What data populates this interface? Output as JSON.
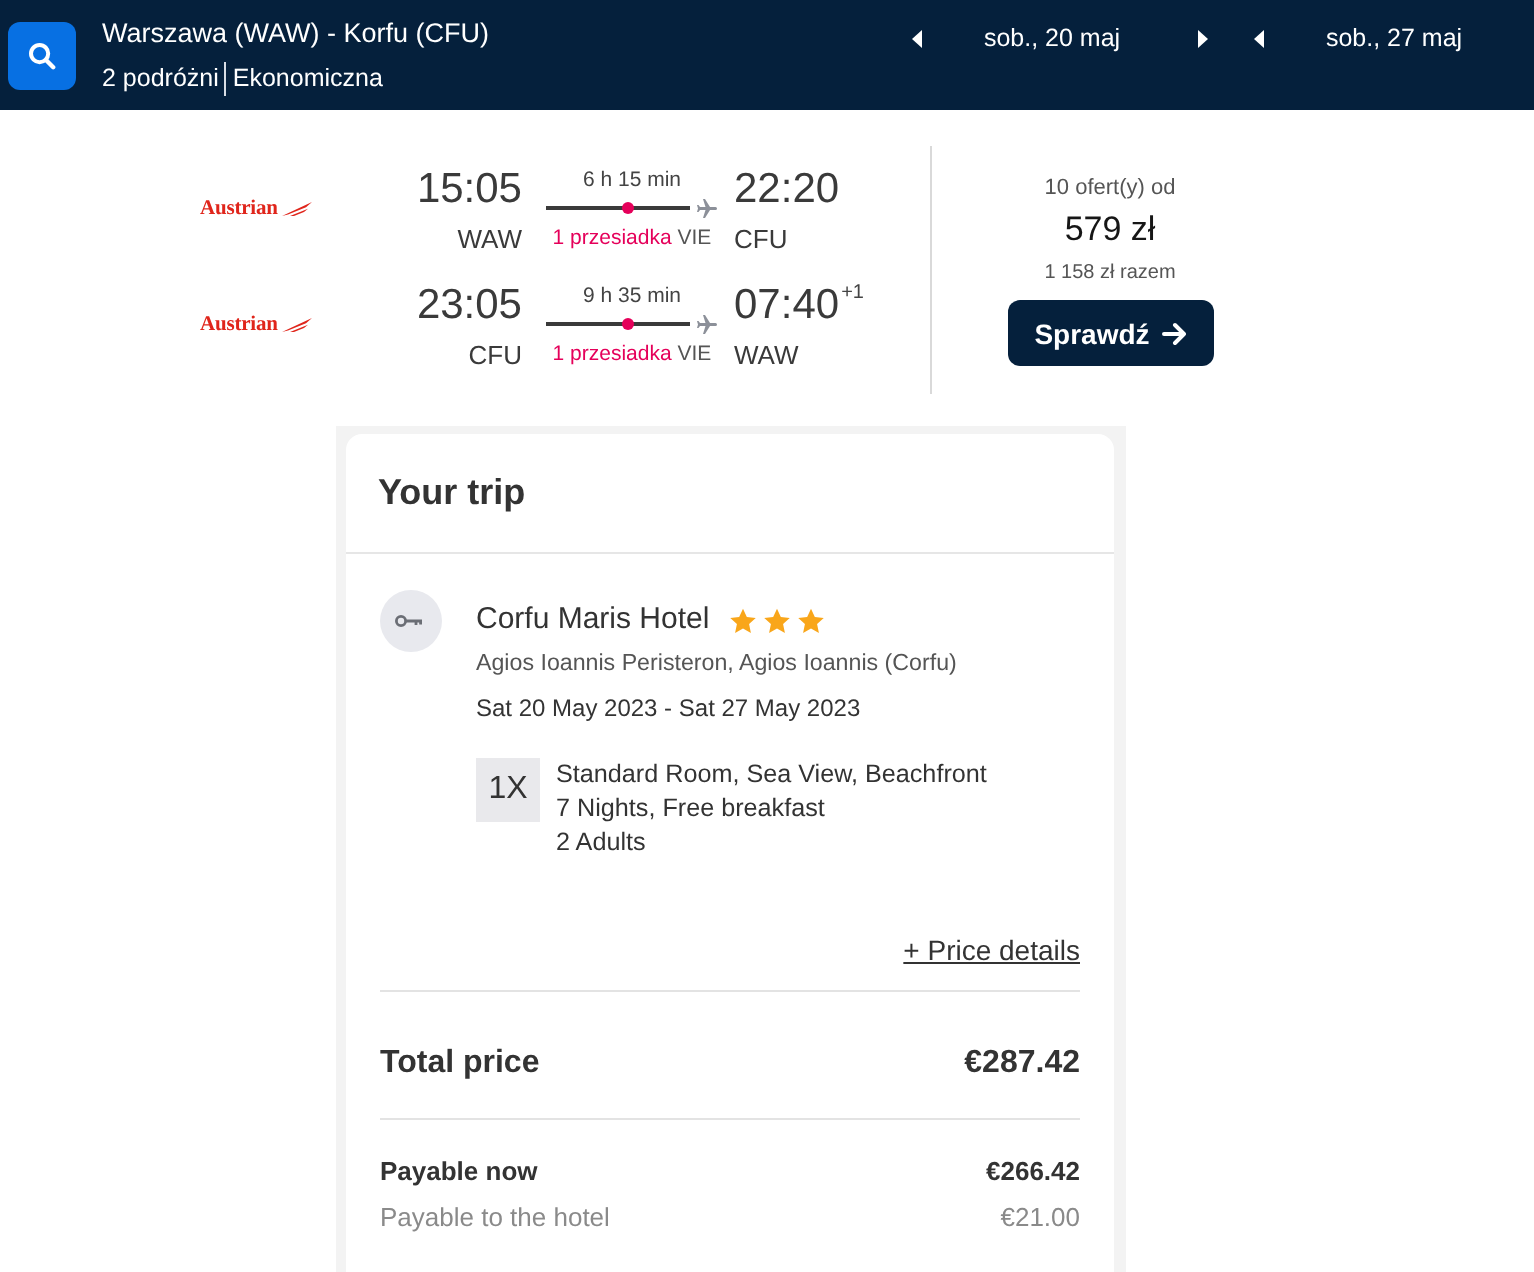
{
  "header": {
    "title": "Warszawa (WAW) - Korfu (CFU)",
    "travellers": "2 podróżni",
    "cabin": "Ekonomiczna",
    "dates": [
      "sob., 20 maj",
      "sob., 27 maj"
    ]
  },
  "flight_result": {
    "legs": [
      {
        "airline": "Austrian",
        "depart_time": "15:05",
        "depart_airport": "WAW",
        "duration": "6 h 15 min",
        "stops": "1 przesiadka",
        "via": "VIE",
        "arrive_time": "22:20",
        "arrive_airport": "CFU"
      },
      {
        "airline": "Austrian",
        "depart_time": "23:05",
        "depart_airport": "CFU",
        "duration": "9 h 35 min",
        "stops": "1 przesiadka",
        "via": "VIE",
        "arrive_time": "07:40",
        "day_offset": "+1",
        "arrive_airport": "WAW"
      }
    ],
    "offers": "10 ofert(y) od",
    "price": "579 zł",
    "total": "1 158 zł razem",
    "button": "Sprawdź"
  },
  "trip": {
    "title": "Your trip",
    "hotel": {
      "name": "Corfu Maris Hotel",
      "stars": 3,
      "address": "Agios Ioannis Peristeron, Agios Ioannis (Corfu)",
      "dates": "Sat 20 May 2023 - Sat 27 May 2023"
    },
    "room": {
      "quantity": "1X",
      "lines": [
        "Standard Room, Sea View, Beachfront",
        "7 Nights, Free breakfast",
        "2 Adults"
      ]
    },
    "price_details_link": "+ Price details",
    "total": {
      "label": "Total price",
      "value": "€287.42"
    },
    "payments": [
      {
        "kind": "now",
        "label": "Payable now",
        "value": "€266.42"
      },
      {
        "kind": "hotel",
        "label": "Payable to the hotel",
        "value": "€21.00"
      }
    ]
  }
}
